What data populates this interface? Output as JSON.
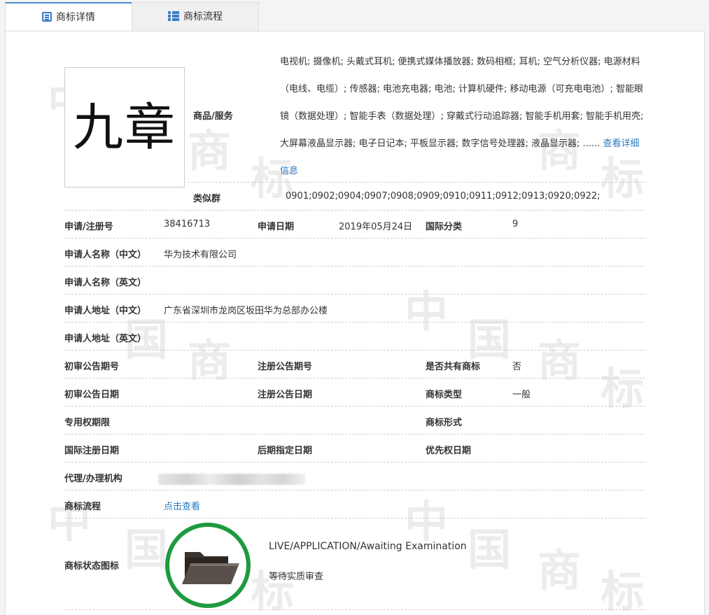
{
  "tabs": [
    {
      "label": "商标详情",
      "icon": "list-icon",
      "active": true
    },
    {
      "label": "商标流程",
      "icon": "grid-list-icon",
      "active": false
    }
  ],
  "trademark": {
    "logo_text": "九章",
    "goods_label": "商品/服务",
    "goods_text": "电视机; 摄像机; 头戴式耳机; 便携式媒体播放器; 数码相框; 耳机; 空气分析仪器; 电源材料（电线、电缆）; 传感器; 电池充电器; 电池; 计算机硬件; 移动电源（可充电电池）; 智能眼镜（数据处理）; 智能手表（数据处理）; 穿戴式行动追踪器; 智能手机用套; 智能手机用壳; 大屏幕液晶显示器; 电子日记本; 平板显示器; 数字信号处理器; 液晶显示器; ......",
    "goods_more_link": "查看详细信息",
    "similar_group_label": "类似群",
    "similar_group_value": "0901;0902;0904;0907;0908;0909;0910;0911;0912;0913;0920;0922;"
  },
  "fields": {
    "reg_no_label": "申请/注册号",
    "reg_no": "38416713",
    "apply_date_label": "申请日期",
    "apply_date": "2019年05月24日",
    "intl_class_label": "国际分类",
    "intl_class": "9",
    "applicant_cn_label": "申请人名称（中文）",
    "applicant_cn": "华为技术有限公司",
    "applicant_en_label": "申请人名称（英文）",
    "applicant_en": "",
    "address_cn_label": "申请人地址（中文）",
    "address_cn": "广东省深圳市龙岗区坂田华为总部办公楼",
    "address_en_label": "申请人地址（英文）",
    "address_en": "",
    "prelim_no_label": "初审公告期号",
    "prelim_no": "",
    "reg_notice_no_label": "注册公告期号",
    "reg_notice_no": "",
    "shared_label": "是否共有商标",
    "shared": "否",
    "prelim_date_label": "初审公告日期",
    "prelim_date": "",
    "reg_notice_date_label": "注册公告日期",
    "reg_notice_date": "",
    "tm_type_label": "商标类型",
    "tm_type": "一般",
    "exclusive_label": "专用权期限",
    "exclusive": "",
    "tm_form_label": "商标形式",
    "tm_form": "",
    "intl_reg_date_label": "国际注册日期",
    "intl_reg_date": "",
    "later_designation_label": "后期指定日期",
    "later_designation": "",
    "priority_date_label": "优先权日期",
    "priority_date": "",
    "agent_label": "代理/办理机构",
    "agent": "",
    "process_label": "商标流程",
    "process_link": "点击查看",
    "status_icon_label": "商标状态图标",
    "status_en": "LIVE/APPLICATION/Awaiting Examination",
    "status_cn": "等待实质审查"
  },
  "watermark": [
    "中",
    "国",
    "商",
    "标"
  ],
  "colors": {
    "accent": "#2a7ac2",
    "status_ring": "#1e9a3f",
    "prev_arrow": "#f08a16",
    "next_arrow": "#5b9bd5"
  },
  "nav": {
    "prev_icon": "chevron-left-icon",
    "next_icon": "chevron-right-icon"
  }
}
